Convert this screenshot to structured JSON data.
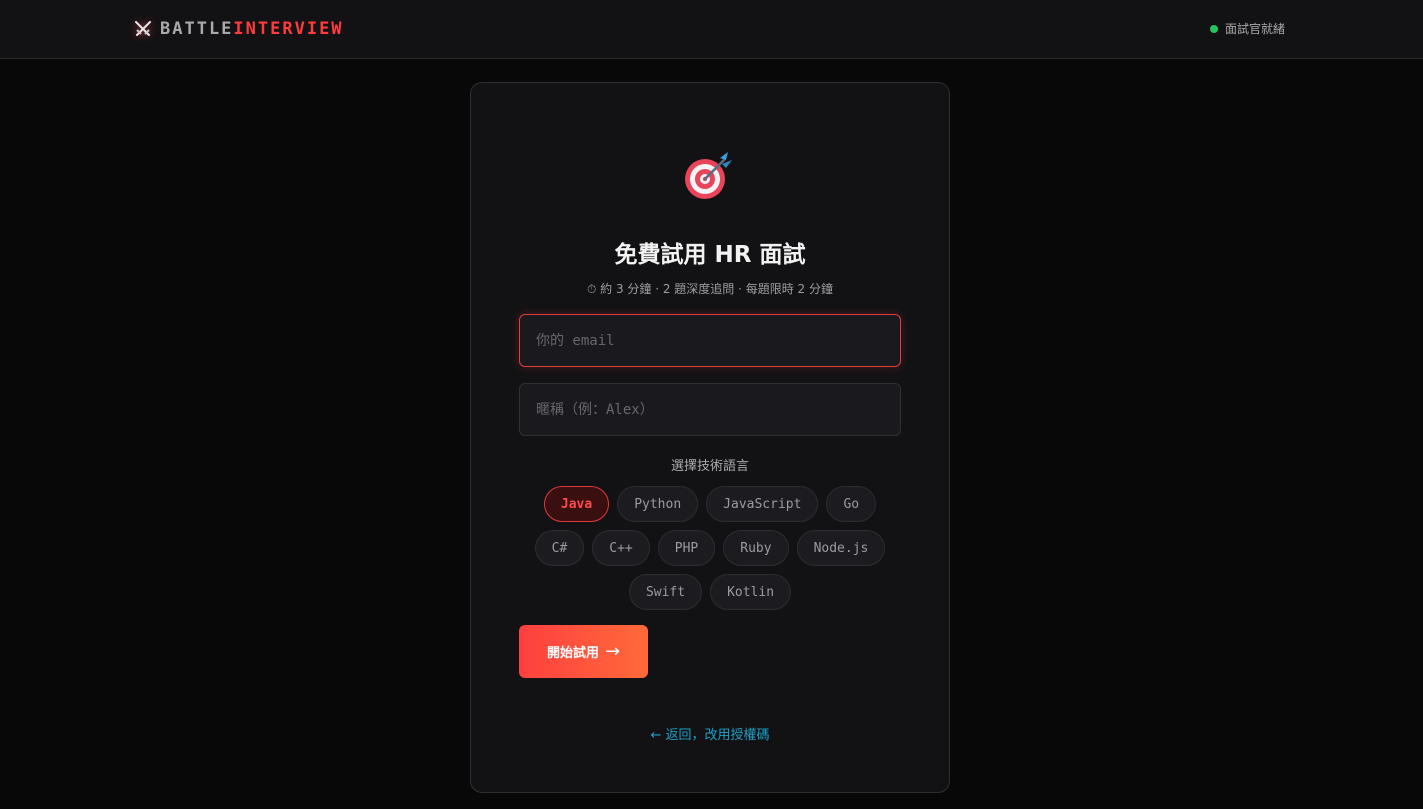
{
  "header": {
    "brand_part1": "BATTLE",
    "brand_part2": "INTERVIEW",
    "status_text": "面試官就緒",
    "status_color": "#22c55e"
  },
  "card": {
    "title": "免費試用 HR 面試",
    "subtitle": "⏱ 約 3 分鐘 · 2 題深度追問 · 每題限時 2 分鐘",
    "email": {
      "value": "",
      "placeholder": "你的 email"
    },
    "nickname": {
      "value": "",
      "placeholder": "暱稱（例：Alex）"
    },
    "language_label": "選擇技術語言",
    "languages": [
      {
        "label": "Java",
        "selected": true
      },
      {
        "label": "Python",
        "selected": false
      },
      {
        "label": "JavaScript",
        "selected": false
      },
      {
        "label": "Go",
        "selected": false
      },
      {
        "label": "C#",
        "selected": false
      },
      {
        "label": "C++",
        "selected": false
      },
      {
        "label": "PHP",
        "selected": false
      },
      {
        "label": "Ruby",
        "selected": false
      },
      {
        "label": "Node.js",
        "selected": false
      },
      {
        "label": "Swift",
        "selected": false
      },
      {
        "label": "Kotlin",
        "selected": false
      }
    ],
    "start_label": "開始試用",
    "start_arrow": "→",
    "back_link": "← 返回，改用授權碼"
  },
  "colors": {
    "accent": "#ff3b3b",
    "link": "#1ea0c8",
    "background": "#080808",
    "card": "#121214"
  },
  "icons": {
    "brand": "crossed-swords-icon",
    "hero": "target-dart-icon"
  }
}
